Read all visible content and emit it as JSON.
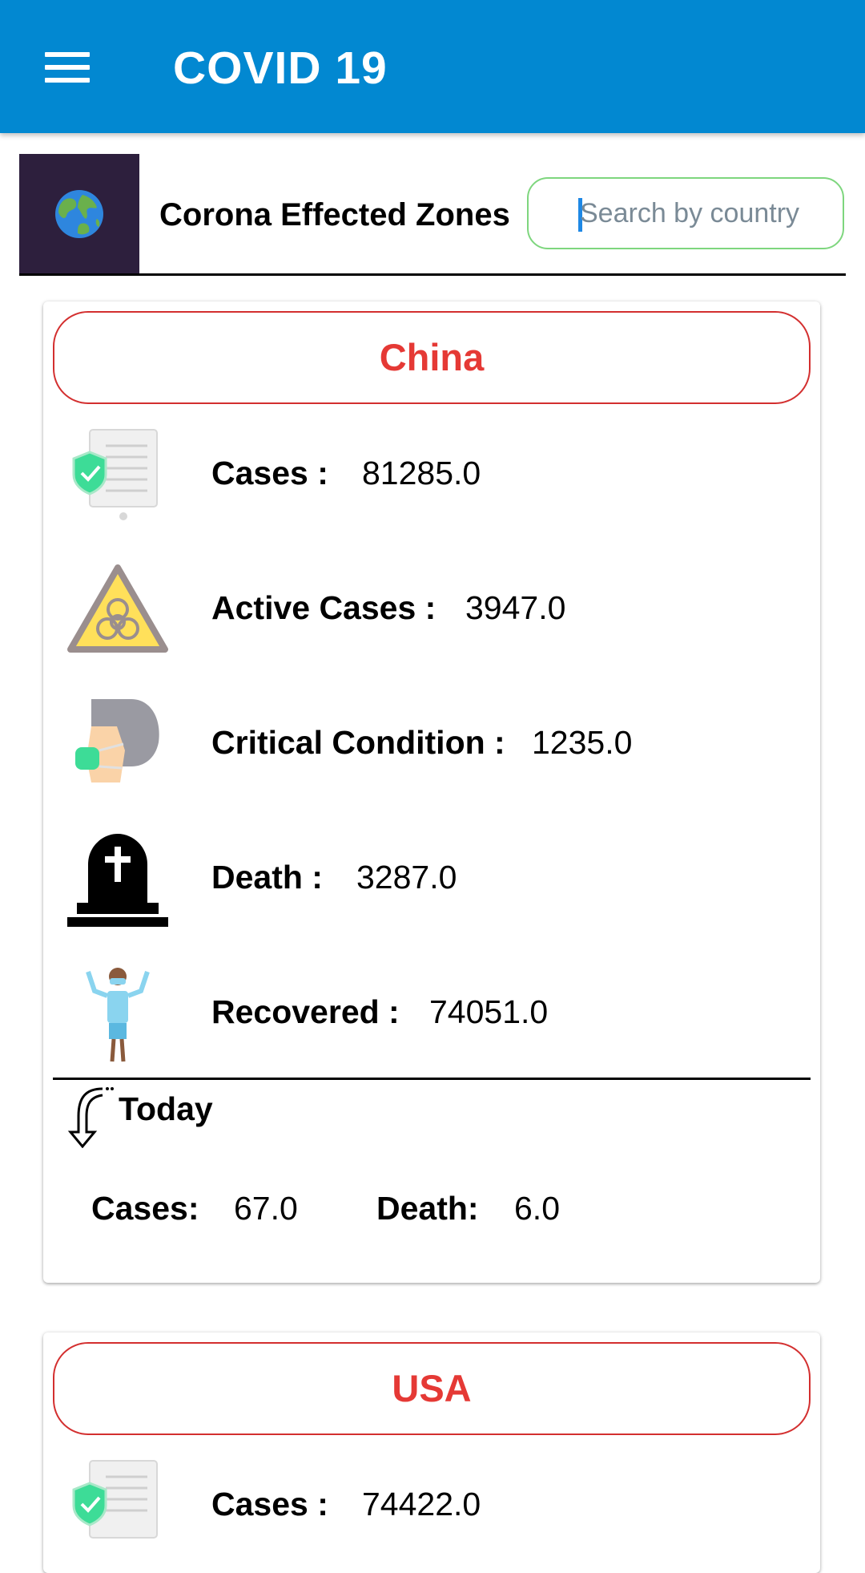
{
  "app": {
    "title": "COVID 19",
    "theme_color": "#0288d1"
  },
  "header": {
    "title": "Corona Effected Zones",
    "search_placeholder": "Search by country",
    "icon": "globe-icon"
  },
  "countries": [
    {
      "name": "China",
      "stats": [
        {
          "label": "Cases :",
          "value": "81285.0",
          "icon": "document-shield-icon"
        },
        {
          "label": "Active Cases :",
          "value": "3947.0",
          "icon": "biohazard-icon"
        },
        {
          "label": "Critical Condition :",
          "value": "1235.0",
          "icon": "masked-person-icon"
        },
        {
          "label": "Death :",
          "value": "3287.0",
          "icon": "tombstone-icon"
        },
        {
          "label": "Recovered :",
          "value": "74051.0",
          "icon": "recovered-person-icon"
        }
      ],
      "today": {
        "label": "Today",
        "cases_label": "Cases:",
        "cases_value": "67.0",
        "death_label": "Death:",
        "death_value": "6.0"
      }
    },
    {
      "name": "USA",
      "stats": [
        {
          "label": "Cases :",
          "value": "74422.0",
          "icon": "document-shield-icon"
        }
      ]
    }
  ],
  "colors": {
    "country_border": "#d32f2f",
    "country_text": "#e53935",
    "search_border": "#7ed67e"
  }
}
